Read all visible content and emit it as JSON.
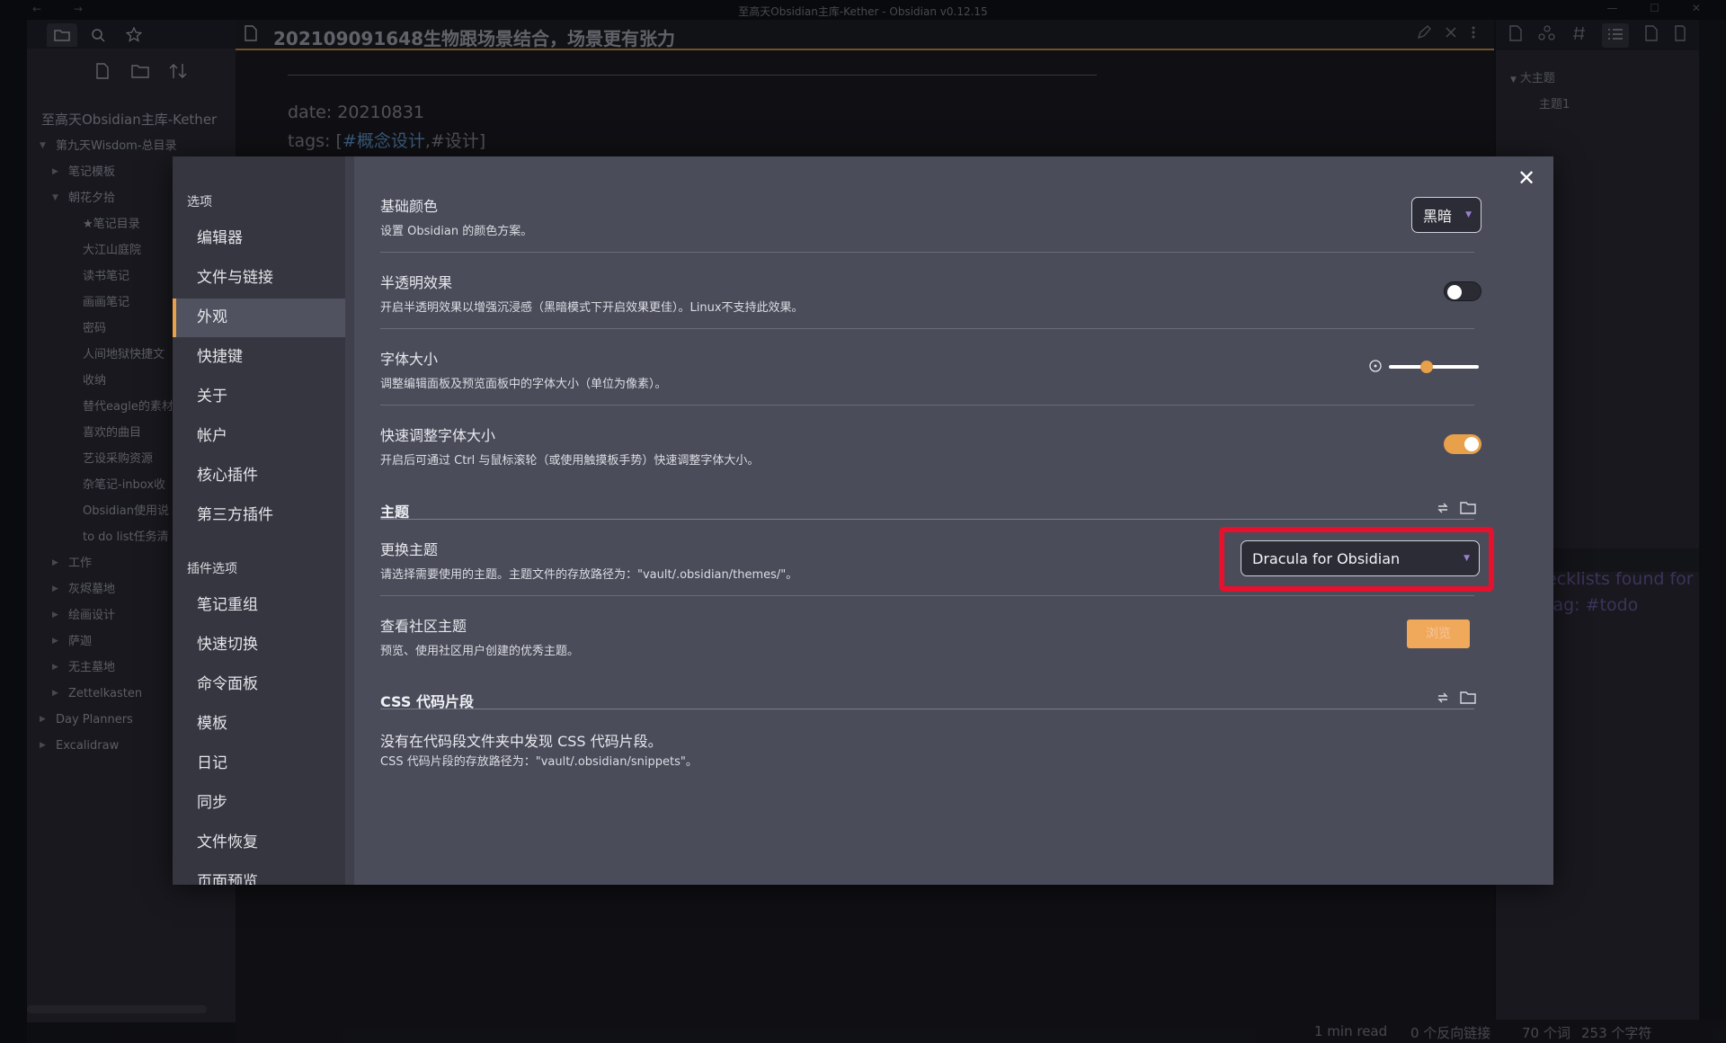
{
  "window": {
    "title": "至高天Obsidian主库-Kether - Obsidian v0.12.15",
    "nav_arrows": "← →",
    "controls": "— ☐ ✕"
  },
  "left_sidebar": {
    "vault_name": "至高天Obsidian主库-Kether",
    "tree": [
      {
        "label": "第九天Wisdom-总目录",
        "level": 0,
        "caret": "▼"
      },
      {
        "label": "笔记模板",
        "level": 1,
        "caret": "▶"
      },
      {
        "label": "朝花夕拾",
        "level": 1,
        "caret": "▼"
      },
      {
        "label": "★笔记目录",
        "level": 2,
        "caret": ""
      },
      {
        "label": "大江山庭院",
        "level": 2,
        "caret": ""
      },
      {
        "label": "读书笔记",
        "level": 2,
        "caret": ""
      },
      {
        "label": "画画笔记",
        "level": 2,
        "caret": ""
      },
      {
        "label": "密码",
        "level": 2,
        "caret": ""
      },
      {
        "label": "人间地狱快捷文",
        "level": 2,
        "caret": ""
      },
      {
        "label": "收纳",
        "level": 2,
        "caret": ""
      },
      {
        "label": "替代eagle的素材",
        "level": 2,
        "caret": ""
      },
      {
        "label": "喜欢的曲目",
        "level": 2,
        "caret": ""
      },
      {
        "label": "艺设采购资源",
        "level": 2,
        "caret": ""
      },
      {
        "label": "杂笔记-inbox收",
        "level": 2,
        "caret": ""
      },
      {
        "label": "Obsidian使用说",
        "level": 2,
        "caret": ""
      },
      {
        "label": "to do list任务清",
        "level": 2,
        "caret": ""
      },
      {
        "label": "工作",
        "level": 1,
        "caret": "▶"
      },
      {
        "label": "灰烬墓地",
        "level": 1,
        "caret": "▶"
      },
      {
        "label": "绘画设计",
        "level": 1,
        "caret": "▶"
      },
      {
        "label": "萨迦",
        "level": 1,
        "caret": "▶"
      },
      {
        "label": "无主墓地",
        "level": 1,
        "caret": "▶"
      },
      {
        "label": "Zettelkasten",
        "level": 1,
        "caret": "▶"
      },
      {
        "label": "Day Planners",
        "level": 0,
        "caret": "▶"
      },
      {
        "label": "Excalidraw",
        "level": 0,
        "caret": "▶"
      }
    ]
  },
  "editor": {
    "doc_title": "202109091648生物跟场景结合，场景更有张力",
    "date_line": "date: 20210831",
    "tags_prefix": "tags: [",
    "tag1": "#概念设计",
    "tags_sep": ",#设计]"
  },
  "right_sidebar": {
    "outline": [
      {
        "label": "大主题",
        "caret": "▼"
      },
      {
        "label": "主题1",
        "caret": ""
      }
    ],
    "checklists_text": "Checklists found for tag: #todo",
    "checklists_visible": "ecklists found for tag: #todo"
  },
  "statusbar": {
    "read_time": "1 min read",
    "backlinks": "0 个反向链接",
    "words": "70 个词",
    "chars": "253 个字符"
  },
  "settings_modal": {
    "nav": {
      "section_options": "选项",
      "options": [
        "编辑器",
        "文件与链接",
        "外观",
        "快捷键",
        "关于",
        "帐户",
        "核心插件",
        "第三方插件"
      ],
      "active_index": 2,
      "section_plugins": "插件选项",
      "plugins": [
        "笔记重组",
        "快速切换",
        "命令面板",
        "模板",
        "日记",
        "同步",
        "文件恢复",
        "页面预览"
      ]
    },
    "close_label": "✕",
    "base_color": {
      "name": "基础颜色",
      "desc": "设置 Obsidian 的颜色方案。",
      "value": "黑暗"
    },
    "translucency": {
      "name": "半透明效果",
      "desc": "开启半透明效果以增强沉浸感（黑暗模式下开启效果更佳）。Linux不支持此效果。",
      "enabled": false
    },
    "font_size": {
      "name": "字体大小",
      "desc": "调整编辑面板及预览面板中的字体大小（单位为像素）。",
      "slider_level": 0.42
    },
    "quick_font": {
      "name": "快速调整字体大小",
      "desc": "开启后可通过 Ctrl 与鼠标滚轮（或使用触摸板手势）快速调整字体大小。",
      "enabled": true
    },
    "theme_section": "主题",
    "change_theme": {
      "name": "更换主题",
      "desc": "请选择需要使用的主题。主题文件的存放路径为：\"vault/.obsidian/themes/\"。",
      "value": "Dracula for Obsidian"
    },
    "community_themes": {
      "name": "查看社区主题",
      "desc": "预览、使用社区用户创建的优秀主题。",
      "button": "浏览"
    },
    "css_section": "CSS 代码片段",
    "css_empty": "没有在代码段文件夹中发现 CSS 代码片段。",
    "css_path": "CSS 代码片段的存放路径为：\"vault/.obsidian/snippets\"。"
  },
  "colors": {
    "accent": "#e8a04a",
    "highlight": "#e8112d",
    "dropdown_arrow": "#9b7fd0",
    "toggle_off": "#2a2b33"
  }
}
